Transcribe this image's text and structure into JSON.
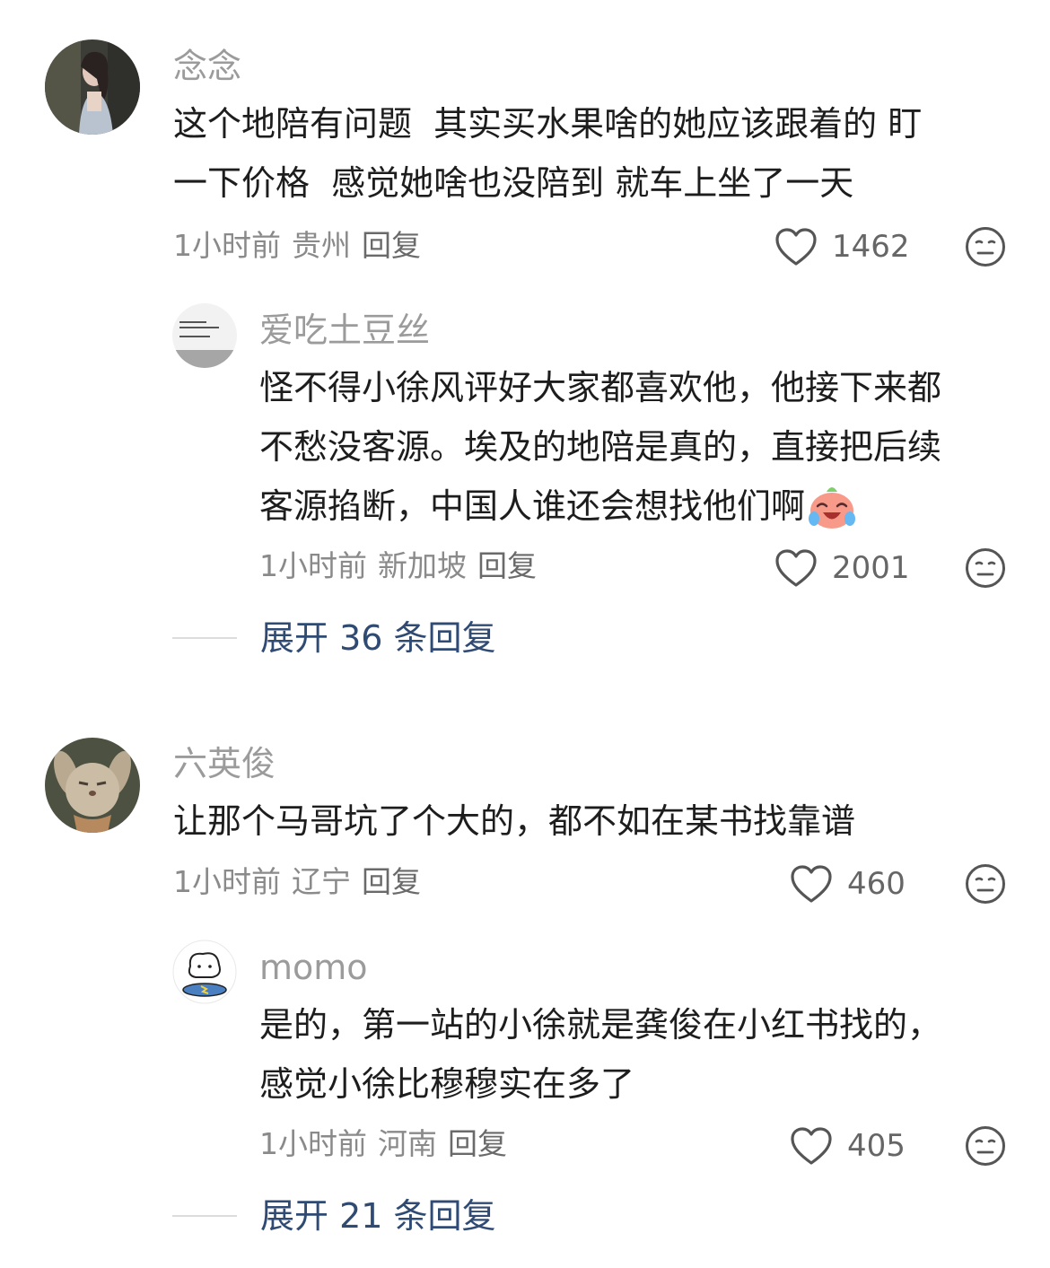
{
  "comments": [
    {
      "username": "念念",
      "lines": [
        "这个地陪有问题  其实买水果啥的她应该跟着的 盯",
        "一下价格  感觉她啥也没陪到 就车上坐了一天"
      ],
      "time": "1小时前",
      "location": "贵州",
      "reply_label": "回复",
      "likes": "1462",
      "avatar_icon": "woman-portrait-avatar",
      "replies": [
        {
          "username": "爱吃土豆丝",
          "lines": [
            "怪不得小徐风评好大家都喜欢他，他接下来都",
            "不愁没客源。埃及的地陪是真的，直接把后续",
            "客源掐断，中国人谁还会想找他们啊"
          ],
          "emoji_icon": "crying-laughing-emoji-icon",
          "time": "1小时前",
          "location": "新加坡",
          "reply_label": "回复",
          "likes": "2001",
          "avatar_text": "Love yourself and keep away from SB",
          "avatar_text_cn": "爱自己，远离傻逼"
        }
      ],
      "expand_label": "展开 36 条回复"
    },
    {
      "username": "六英俊",
      "lines": [
        "让那个马哥坑了个大的，都不如在某书找靠谱"
      ],
      "time": "1小时前",
      "location": "辽宁",
      "reply_label": "回复",
      "likes": "460",
      "avatar_icon": "cartoon-rabbit-avatar",
      "replies": [
        {
          "username": "momo",
          "lines": [
            "是的，第一站的小徐就是龚俊在小红书找的，",
            "感觉小徐比穆穆实在多了"
          ],
          "time": "1小时前",
          "location": "河南",
          "reply_label": "回复",
          "likes": "405",
          "avatar_icon": "cartoon-dog-surfboard-avatar"
        }
      ],
      "expand_label": "展开 21 条回复"
    }
  ],
  "colors": {
    "username": "#9b9b9b",
    "body_text": "#1d1d1d",
    "meta": "#8a8a8a",
    "expand_link": "#2f4a73"
  }
}
